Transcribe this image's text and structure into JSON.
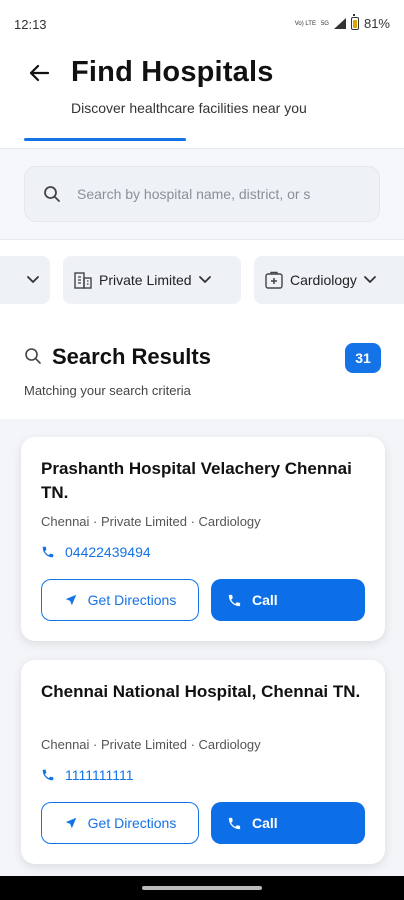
{
  "status_bar": {
    "time": "12:13",
    "battery": "81%",
    "network_top": "Vo) LTE",
    "network_type": "5G"
  },
  "header": {
    "title": "Find Hospitals",
    "subtitle": "Discover healthcare facilities near you"
  },
  "search": {
    "placeholder": "Search by hospital name, district, or s",
    "value": ""
  },
  "filters": [
    {
      "label": ""
    },
    {
      "label": "Private Limited",
      "icon": "building-icon"
    },
    {
      "label": "Cardiology",
      "icon": "medical-plus-icon"
    }
  ],
  "results": {
    "title": "Search Results",
    "count": "31",
    "subtitle": "Matching your search criteria"
  },
  "hospitals": [
    {
      "name": "Prashanth Hospital Velachery Chennai TN.",
      "meta": "Chennai · Private Limited · Cardiology",
      "phone": "04422439494",
      "directions_label": "Get Directions",
      "call_label": "Call"
    },
    {
      "name": "Chennai National Hospital, Chennai TN.",
      "meta": "Chennai · Private Limited · Cardiology",
      "phone": "1111111111",
      "directions_label": "Get Directions",
      "call_label": "Call"
    }
  ],
  "colors": {
    "accent": "#1473e6",
    "background": "#f3f5f9"
  }
}
